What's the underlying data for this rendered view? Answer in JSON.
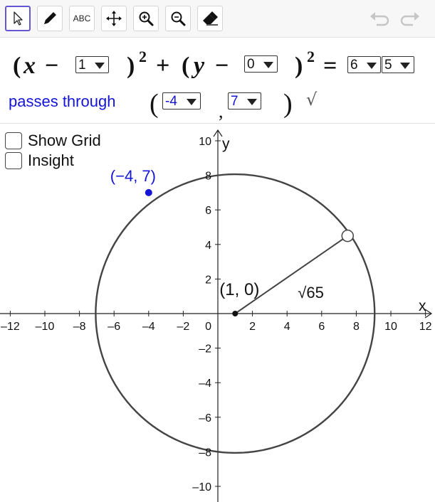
{
  "toolbar": {
    "tools": [
      {
        "name": "move-tool",
        "icon": "cursor-arrow-icon",
        "active": true
      },
      {
        "name": "pen-tool",
        "icon": "pencil-icon"
      },
      {
        "name": "text-tool",
        "icon": "text-abc-icon",
        "label": "ABC"
      },
      {
        "name": "move-graphics-tool",
        "icon": "move-arrows-icon"
      },
      {
        "name": "zoom-in-tool",
        "icon": "zoom-in-icon"
      },
      {
        "name": "zoom-out-tool",
        "icon": "zoom-out-icon"
      },
      {
        "name": "eraser-tool",
        "icon": "eraser-icon"
      }
    ],
    "undo_icon": "undo-icon",
    "redo_icon": "redo-icon"
  },
  "equation": {
    "h_value": "1",
    "k_value": "0",
    "rhs_value_1": "6",
    "rhs_value_2": "5",
    "sym_open": "(",
    "sym_x": "x",
    "sym_y": "y",
    "sym_minus": "−",
    "sym_close": ")",
    "sym_square": "2",
    "sym_plus": "+",
    "sym_equals": "=",
    "passes_label": "passes through",
    "point_x_value": "-4",
    "point_y_value": "7",
    "point_comma": ",",
    "check_mark": "√"
  },
  "checkboxes": {
    "show_grid": {
      "label": "Show Grid",
      "checked": false
    },
    "insight": {
      "label": "Insight",
      "checked": false
    }
  },
  "graph": {
    "x_axis_label": "x",
    "y_axis_label": "y",
    "x_ticks": [
      -12,
      -10,
      -8,
      -6,
      -4,
      -2,
      2,
      4,
      6,
      8,
      10,
      12
    ],
    "y_ticks": [
      -10,
      -8,
      -6,
      -4,
      -2,
      2,
      4,
      6,
      8,
      10
    ],
    "origin_label": "0",
    "circle_center": [
      1,
      0
    ],
    "circle_radius_squared": 65,
    "center_label": "(1, 0)",
    "radius_label": "√65",
    "radius_point": [
      7.5,
      4.5
    ],
    "given_point": [
      -4,
      7
    ],
    "given_point_label": "(−4, 7)",
    "colors": {
      "circle": "#444444",
      "given_point": "#1515d8",
      "axes": "#222222",
      "active_tool_border": "#6557d2"
    }
  }
}
